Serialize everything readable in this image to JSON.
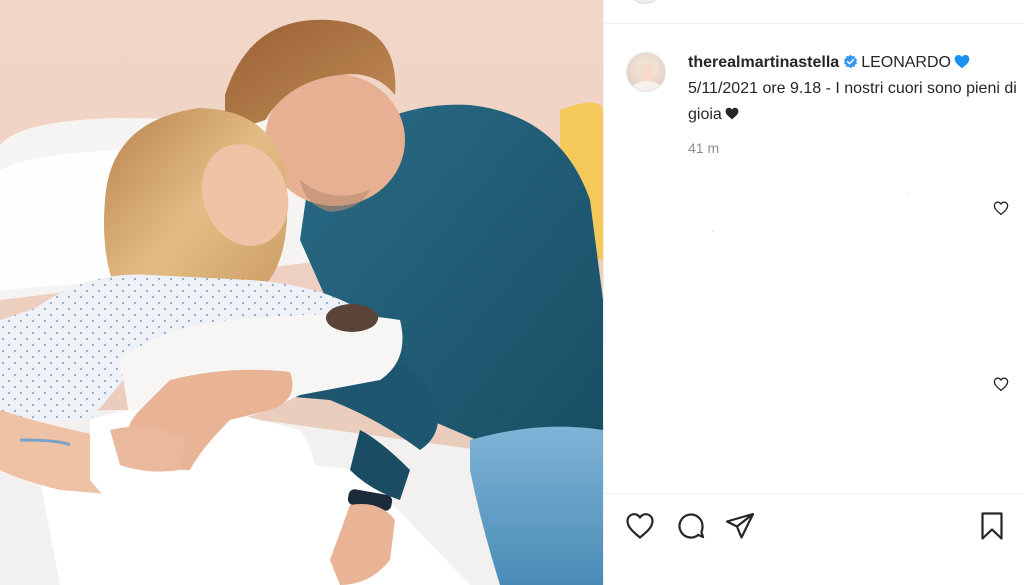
{
  "post": {
    "username": "therealmartinastella",
    "verified": true,
    "caption_line1": "LEONARDO",
    "caption_line2": "5/11/2021 ore 9.18 - I nostri cuori sono pieni di gioia",
    "time_ago": "41 m"
  },
  "photo": {
    "description_icon": "family-photo"
  },
  "icons": {
    "like": "heart-outline-icon",
    "comment": "comment-bubble-icon",
    "share": "paper-plane-icon",
    "save": "bookmark-icon",
    "verified": "verified-badge-icon"
  },
  "colors": {
    "verified_blue": "#3897f0",
    "heart_blue": "#1e8ef0",
    "text": "#262626",
    "muted": "#8e8e8e",
    "sweater": "#1f5a72",
    "jeans": "#5b9cc4"
  }
}
